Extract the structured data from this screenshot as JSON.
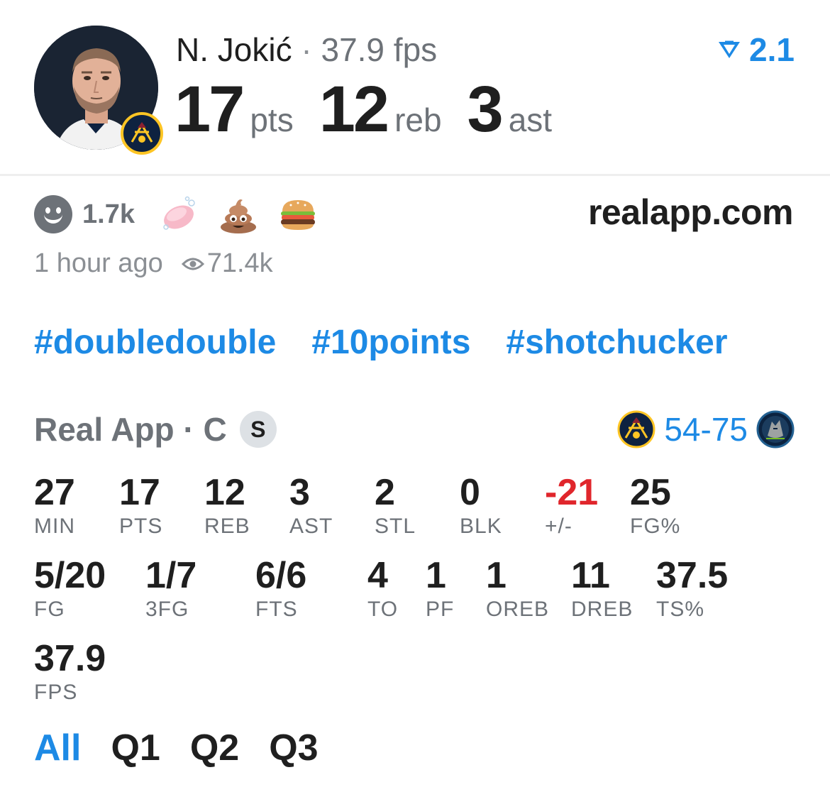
{
  "player": {
    "name": "N. Jokić",
    "separator": "·",
    "fps_label": "37.9 fps",
    "rank": "2.1",
    "big_stats": [
      {
        "value": "17",
        "unit": "pts"
      },
      {
        "value": "12",
        "unit": "reb"
      },
      {
        "value": "3",
        "unit": "ast"
      }
    ]
  },
  "reactions": {
    "count": "1.7k",
    "emojis": [
      "soap-emoji",
      "pile-of-poo-emoji",
      "hamburger-emoji"
    ],
    "site": "realapp.com",
    "time_ago": "1 hour ago",
    "views": "71.4k"
  },
  "hashtags": [
    "#doubledouble",
    "#10points",
    "#shotchucker"
  ],
  "game": {
    "league": "Real App · C",
    "badge": "S",
    "score": "54-75"
  },
  "stats_row1": [
    {
      "value": "27",
      "label": "MIN"
    },
    {
      "value": "17",
      "label": "PTS"
    },
    {
      "value": "12",
      "label": "REB"
    },
    {
      "value": "3",
      "label": "AST"
    },
    {
      "value": "2",
      "label": "STL"
    },
    {
      "value": "0",
      "label": "BLK"
    },
    {
      "value": "-21",
      "label": "+/-"
    },
    {
      "value": "25",
      "label": "FG%"
    }
  ],
  "stats_row2": [
    {
      "value": "5/20",
      "label": "FG"
    },
    {
      "value": "1/7",
      "label": "3FG"
    },
    {
      "value": "6/6",
      "label": "FTS"
    },
    {
      "value": "4",
      "label": "TO"
    },
    {
      "value": "1",
      "label": "PF"
    },
    {
      "value": "1",
      "label": "OREB"
    },
    {
      "value": "11",
      "label": "DREB"
    },
    {
      "value": "37.5",
      "label": "TS%"
    }
  ],
  "stats_row3": [
    {
      "value": "37.9",
      "label": "FPS"
    }
  ],
  "tabs": [
    "All",
    "Q1",
    "Q2",
    "Q3"
  ],
  "colors": {
    "accent": "#1d8ae5",
    "negative": "#e0262c",
    "text": "#1f1f1f",
    "muted": "#6d7278",
    "nuggets_navy": "#0e2240",
    "nuggets_gold": "#fec524"
  }
}
